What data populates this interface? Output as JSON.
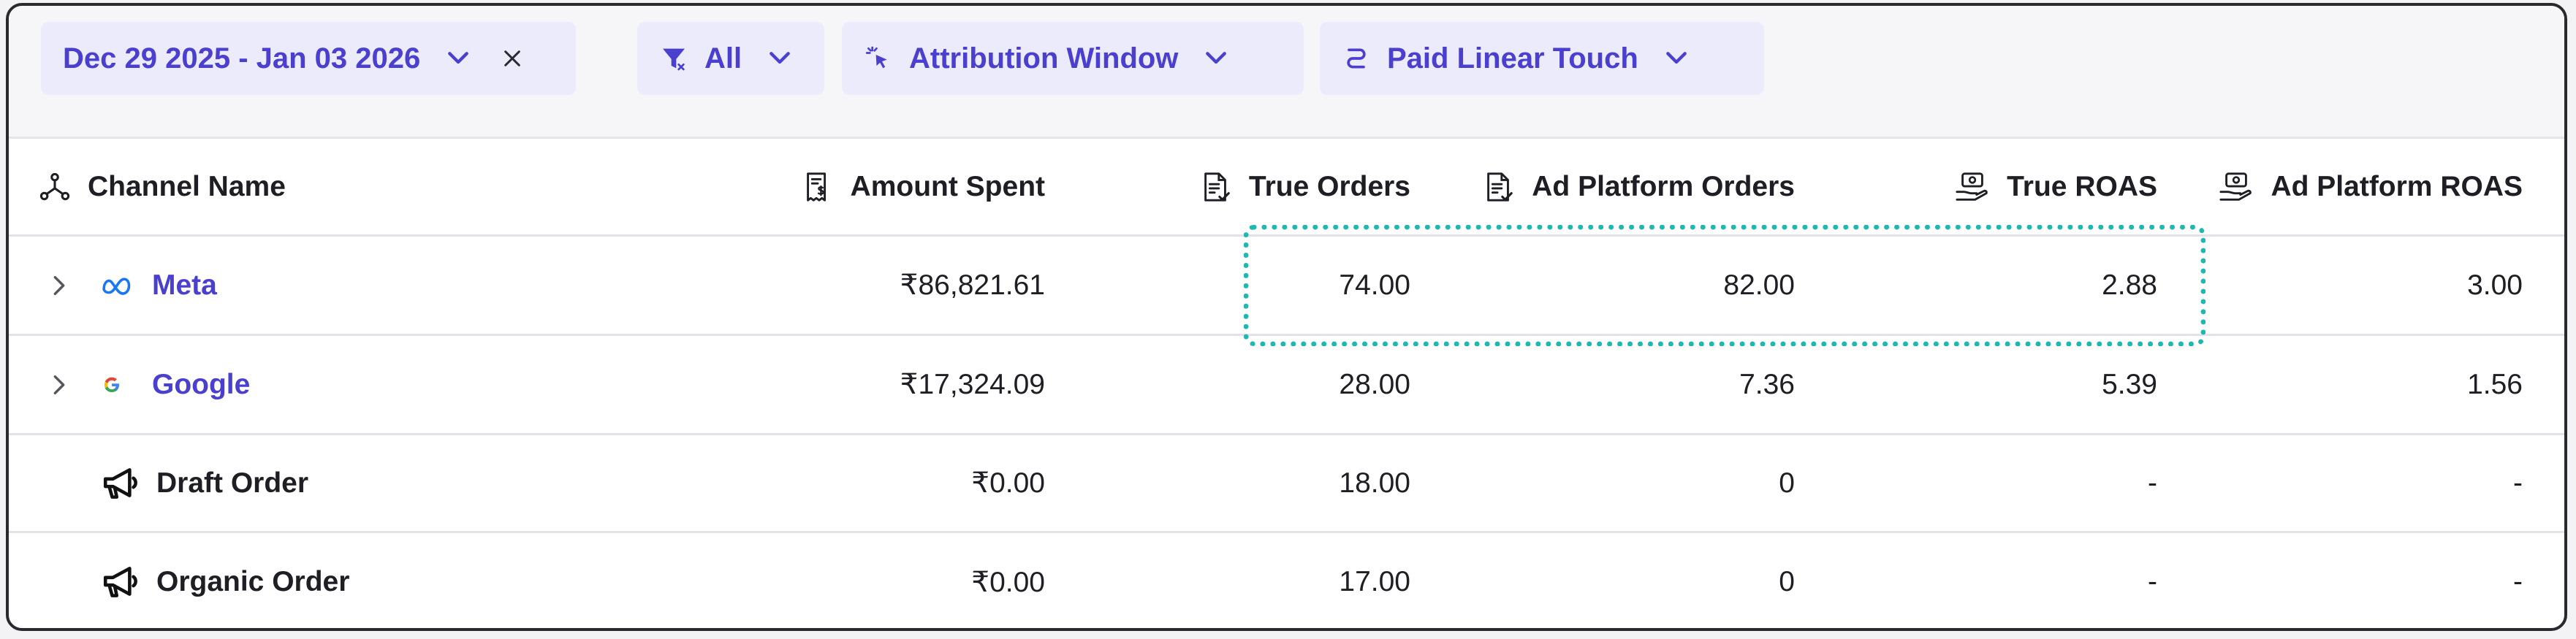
{
  "filters": {
    "date_range": "Dec 29 2025 - Jan 03 2026",
    "segment": "All",
    "attribution_window": "Attribution Window",
    "attribution_model": "Paid Linear Touch"
  },
  "columns": {
    "channel_name": "Channel Name",
    "amount_spent": "Amount Spent",
    "true_orders": "True Orders",
    "ad_platform_orders": "Ad Platform Orders",
    "true_roas": "True ROAS",
    "ad_platform_roas": "Ad Platform ROAS"
  },
  "rows": [
    {
      "name": "Meta",
      "amount_spent": "₹86,821.61",
      "true_orders": "74.00",
      "ad_platform_orders": "82.00",
      "true_roas": "2.88",
      "ad_platform_roas": "3.00"
    },
    {
      "name": "Google",
      "amount_spent": "₹17,324.09",
      "true_orders": "28.00",
      "ad_platform_orders": "7.36",
      "true_roas": "5.39",
      "ad_platform_roas": "1.56"
    },
    {
      "name": "Draft Order",
      "amount_spent": "₹0.00",
      "true_orders": "18.00",
      "ad_platform_orders": "0",
      "true_roas": "-",
      "ad_platform_roas": "-"
    },
    {
      "name": "Organic Order",
      "amount_spent": "₹0.00",
      "true_orders": "17.00",
      "ad_platform_orders": "0",
      "true_roas": "-",
      "ad_platform_roas": "-"
    }
  ],
  "colors": {
    "accent": "#4a3fcf",
    "chip_bg": "#ecebfb",
    "highlight": "#1fb8b0",
    "meta_logo": "#1877f2"
  },
  "icons": {
    "date_chevron": "chevron-down-icon",
    "clear": "close-icon",
    "segment": "filter-icon",
    "attribution_window": "cursor-click-icon",
    "attribution_model": "route-icon",
    "channel_name": "network-icon",
    "amount_spent": "receipt-icon",
    "orders": "document-check-icon",
    "roas": "money-hand-icon",
    "expand": "chevron-right-icon",
    "meta": "meta-logo-icon",
    "google": "google-logo-icon",
    "megaphone": "megaphone-icon"
  }
}
